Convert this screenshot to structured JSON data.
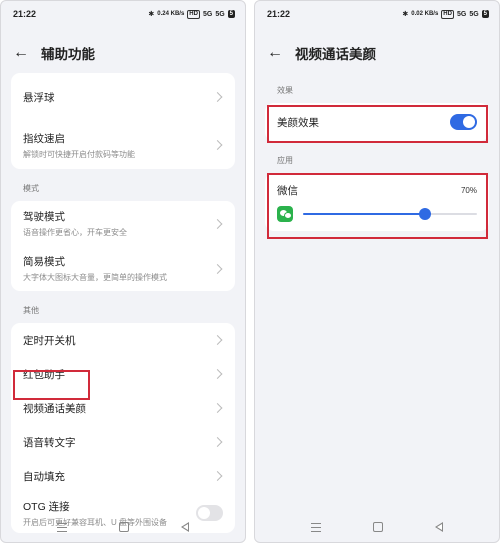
{
  "left": {
    "status": {
      "time": "21:22",
      "speed": "0.24 KB/s",
      "hd": "HD",
      "net1": "5G",
      "net2": "5G",
      "battery": "5"
    },
    "title": "辅助功能",
    "items_top": [
      {
        "title": "悬浮球",
        "subtitle": ""
      },
      {
        "title": "指纹速启",
        "subtitle": "解锁时可快捷开启付款码等功能"
      }
    ],
    "section_mode": "模式",
    "items_mode": [
      {
        "title": "驾驶模式",
        "subtitle": "语音操作更省心，开车更安全"
      },
      {
        "title": "简易模式",
        "subtitle": "大字体大图标大音量，更简单的操作模式"
      }
    ],
    "section_other": "其他",
    "items_other": [
      {
        "title": "定时开关机"
      },
      {
        "title": "红包助手"
      },
      {
        "title": "视频通话美颜"
      },
      {
        "title": "语音转文字"
      },
      {
        "title": "自动填充"
      }
    ],
    "otg": {
      "title": "OTG 连接",
      "subtitle": "开启后可更好兼容耳机、U 盘等外围设备",
      "enabled": false
    }
  },
  "right": {
    "status": {
      "time": "21:22",
      "speed": "0.02 KB/s",
      "hd": "HD",
      "net1": "5G",
      "net2": "5G",
      "battery": "5"
    },
    "title": "视频通话美颜",
    "section_effect": "效果",
    "beauty": {
      "label": "美颜效果",
      "enabled": true
    },
    "section_apps": "应用",
    "app": {
      "name": "微信",
      "percent_label": "70%",
      "level": 0.7
    }
  },
  "colors": {
    "accent": "#2f6ae3",
    "highlight": "#d12a3a",
    "wechat": "#2bb24c"
  }
}
